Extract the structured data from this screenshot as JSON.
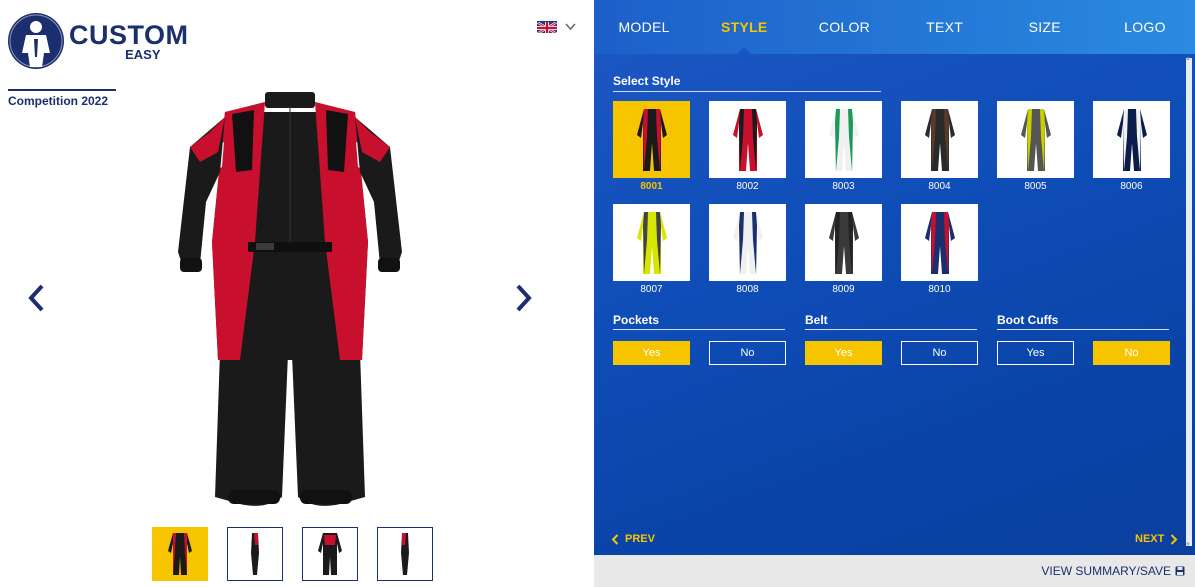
{
  "brand": {
    "name_line1": "CUSTOM",
    "name_line2": "EASY"
  },
  "model_name": "Competition 2022",
  "language": {
    "flag": "uk-flag-icon"
  },
  "tabs": [
    {
      "label": "MODEL",
      "active": false
    },
    {
      "label": "STYLE",
      "active": true
    },
    {
      "label": "COLOR",
      "active": false
    },
    {
      "label": "TEXT",
      "active": false
    },
    {
      "label": "SIZE",
      "active": false
    },
    {
      "label": "LOGO",
      "active": false
    }
  ],
  "select_style": {
    "title": "Select Style",
    "selected": "8001",
    "styles": [
      "8001",
      "8002",
      "8003",
      "8004",
      "8005",
      "8006",
      "8007",
      "8008",
      "8009",
      "8010"
    ]
  },
  "options": [
    {
      "title": "Pockets",
      "yes": "Yes",
      "no": "No",
      "selected": "Yes"
    },
    {
      "title": "Belt",
      "yes": "Yes",
      "no": "No",
      "selected": "Yes"
    },
    {
      "title": "Boot Cuffs",
      "yes": "Yes",
      "no": "No",
      "selected": "No"
    }
  ],
  "nav": {
    "prev": "PREV",
    "next": "NEXT"
  },
  "summary": "VIEW SUMMARY/SAVE",
  "colors": {
    "accent": "#f7c400",
    "brand": "#1b2f6e",
    "panel": "#0f4db8"
  }
}
